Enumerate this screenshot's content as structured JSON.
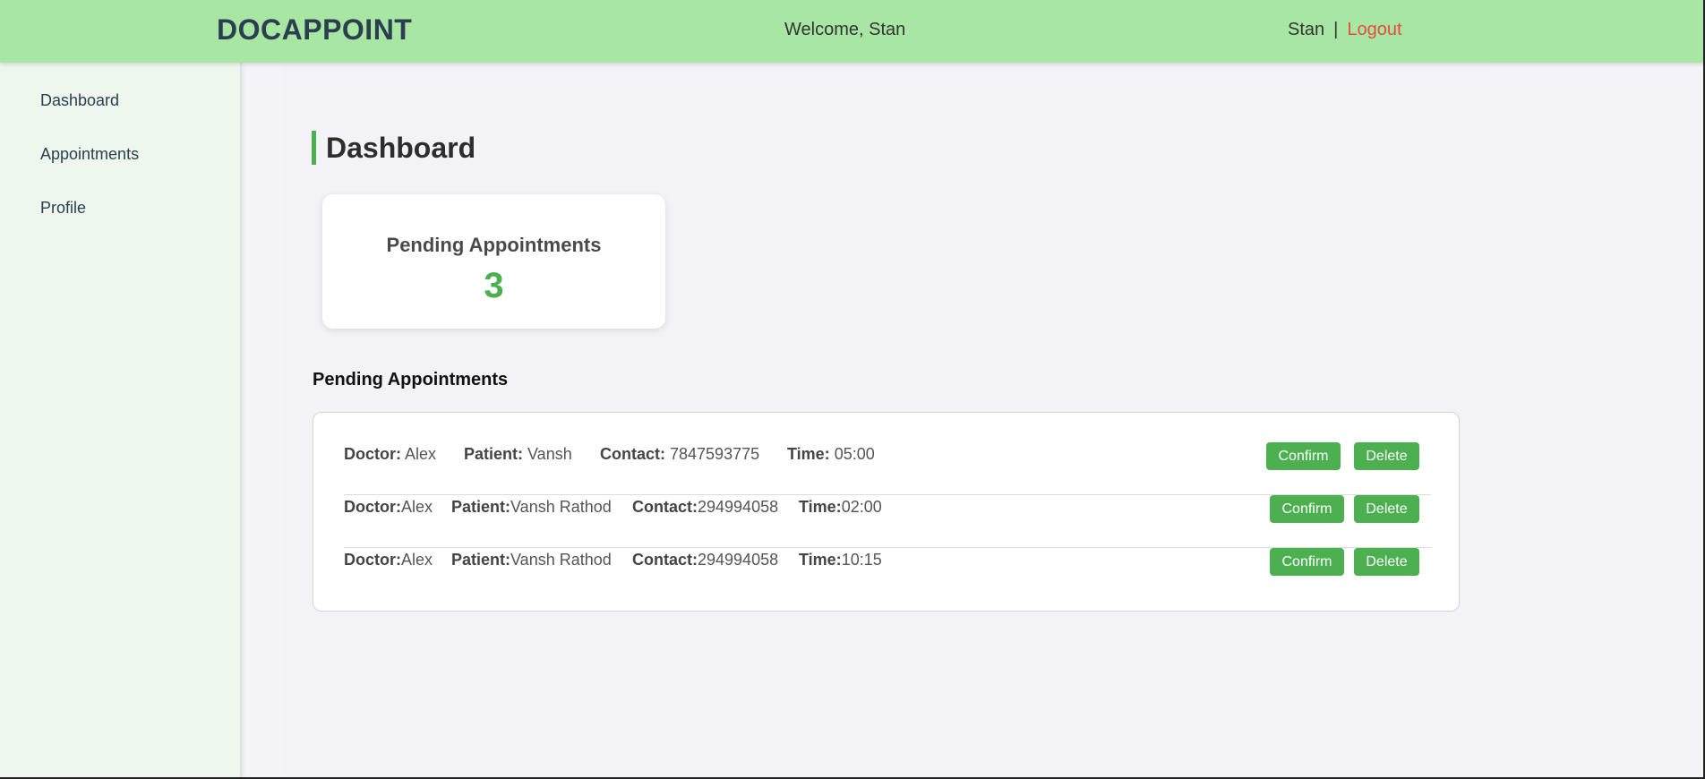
{
  "header": {
    "brand": "DOCAPPOINT",
    "welcome": "Welcome, Stan",
    "username": "Stan",
    "separator": "|",
    "logout_label": "Logout"
  },
  "sidebar": {
    "items": [
      {
        "label": "Dashboard"
      },
      {
        "label": "Appointments"
      },
      {
        "label": "Profile"
      }
    ]
  },
  "main": {
    "title": "Dashboard",
    "stat_card": {
      "label": "Pending Appointments",
      "value": "3"
    },
    "section_heading": "Pending Appointments",
    "appointments": [
      {
        "doctor_label": "Doctor:",
        "doctor": " Alex",
        "patient_label": "Patient:",
        "patient": " Vansh",
        "contact_label": "Contact:",
        "contact": " 7847593775",
        "time_label": "Time:",
        "time": " 05:00",
        "confirm_label": "Confirm",
        "delete_label": "Delete"
      },
      {
        "doctor_label": "Doctor:",
        "doctor": "Alex",
        "patient_label": "Patient:",
        "patient": "Vansh Rathod",
        "contact_label": "Contact:",
        "contact": "294994058",
        "time_label": "Time:",
        "time": "02:00",
        "confirm_label": "Confirm",
        "delete_label": "Delete"
      },
      {
        "doctor_label": "Doctor:",
        "doctor": "Alex",
        "patient_label": "Patient:",
        "patient": "Vansh Rathod",
        "contact_label": "Contact:",
        "contact": "294994058",
        "time_label": "Time:",
        "time": "10:15",
        "confirm_label": "Confirm",
        "delete_label": "Delete"
      }
    ]
  },
  "colors": {
    "header_bg": "#a8e6a3",
    "accent_green": "#4caf50",
    "logout_red": "#e74c3c",
    "sidebar_bg": "#eef7ee",
    "content_bg": "#f2f2f7"
  }
}
